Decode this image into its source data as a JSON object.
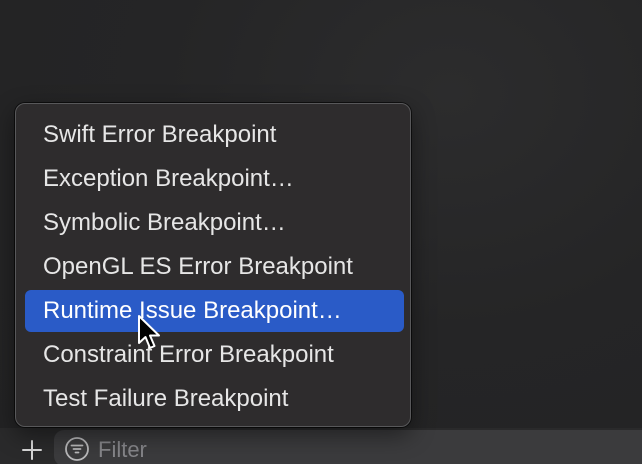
{
  "menu": {
    "items": [
      {
        "label": "Swift Error Breakpoint",
        "highlighted": false
      },
      {
        "label": "Exception Breakpoint…",
        "highlighted": false
      },
      {
        "label": "Symbolic Breakpoint…",
        "highlighted": false
      },
      {
        "label": "OpenGL ES Error Breakpoint",
        "highlighted": false
      },
      {
        "label": "Runtime Issue Breakpoint…",
        "highlighted": true
      },
      {
        "label": "Constraint Error Breakpoint",
        "highlighted": false
      },
      {
        "label": "Test Failure Breakpoint",
        "highlighted": false
      }
    ]
  },
  "bottom_bar": {
    "add_icon": "plus-icon",
    "filter": {
      "icon": "filter-icon",
      "placeholder": "Filter",
      "value": ""
    }
  },
  "colors": {
    "highlight": "#2a5bc7",
    "menu_background": "#2e2c2d",
    "text": "#e6e6e6"
  }
}
